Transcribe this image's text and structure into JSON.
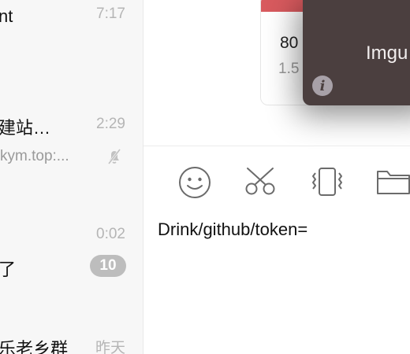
{
  "chat_list": {
    "items": [
      {
        "name": "nt",
        "time": "7:17"
      },
      {
        "name": "建站…",
        "time": "2:29",
        "preview": "kym.top:...",
        "muted": true,
        "icon": "mute-bell-icon"
      },
      {
        "name": "了",
        "time": "0:02",
        "badge": "10"
      },
      {
        "name": "乐老乡群",
        "time": "昨天"
      }
    ]
  },
  "message_card": {
    "number": "80",
    "sub": "1.5"
  },
  "popup": {
    "title": "Imgu",
    "info_glyph": "i"
  },
  "toolbar": {
    "icons": [
      "emoji-icon",
      "scissors-icon",
      "vibrate-icon",
      "folder-icon"
    ]
  },
  "composer": {
    "text": "Drink/github/token="
  },
  "colors": {
    "sidebar_bg": "#f7f7f7",
    "badge_bg": "#bdbdbd",
    "card_strip": "#d85a5e",
    "popup_bg": "#4b3f3f",
    "icon_stroke": "#6b6b6b"
  }
}
